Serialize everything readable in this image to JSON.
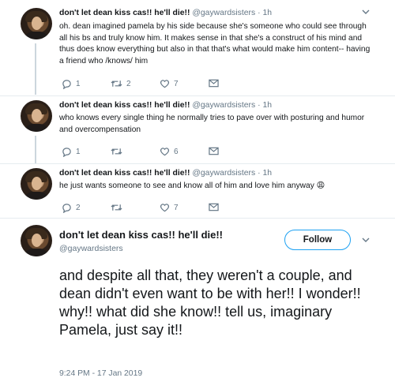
{
  "tweets": [
    {
      "name": "don't let dean kiss cas!! he'll die!!",
      "handle": "@gaywardsisters",
      "dot": "·",
      "time": "1h",
      "text": "oh. dean imagined pamela by his side because she's someone who could see through all his bs and truly know him. It makes sense in that she's a construct of his mind and thus does know everything but also in that that's what would make him content-- having a friend who /knows/ him",
      "replies": "1",
      "retweets": "2",
      "likes": "7"
    },
    {
      "name": "don't let dean kiss cas!! he'll die!!",
      "handle": "@gaywardsisters",
      "dot": "·",
      "time": "1h",
      "text": "who knows every single thing he normally tries to pave over with posturing and humor and overcompensation",
      "replies": "1",
      "retweets": "",
      "likes": "6"
    },
    {
      "name": "don't let dean kiss cas!! he'll die!!",
      "handle": "@gaywardsisters",
      "dot": "·",
      "time": "1h",
      "text": "he just wants someone to see and know all of him and love him anyway 😩",
      "replies": "2",
      "retweets": "",
      "likes": "7"
    }
  ],
  "main_tweet": {
    "name": "don't let dean kiss cas!! he'll die!!",
    "handle": "@gaywardsisters",
    "follow_label": "Follow",
    "text": "and despite all that, they weren't a couple, and dean didn't even want to be with her!! I wonder!! why!! what did she know!! tell us, imaginary Pamela, just say it!!",
    "timestamp": "9:24 PM - 17 Jan 2019"
  },
  "icons": [
    "avatar",
    "chevron-down-icon",
    "reply-icon",
    "retweet-icon",
    "like-icon",
    "message-icon"
  ],
  "colors": {
    "accent": "#1da1f2",
    "secondary_text": "#657786",
    "text": "#14171a",
    "divider": "#e6ecf0"
  }
}
